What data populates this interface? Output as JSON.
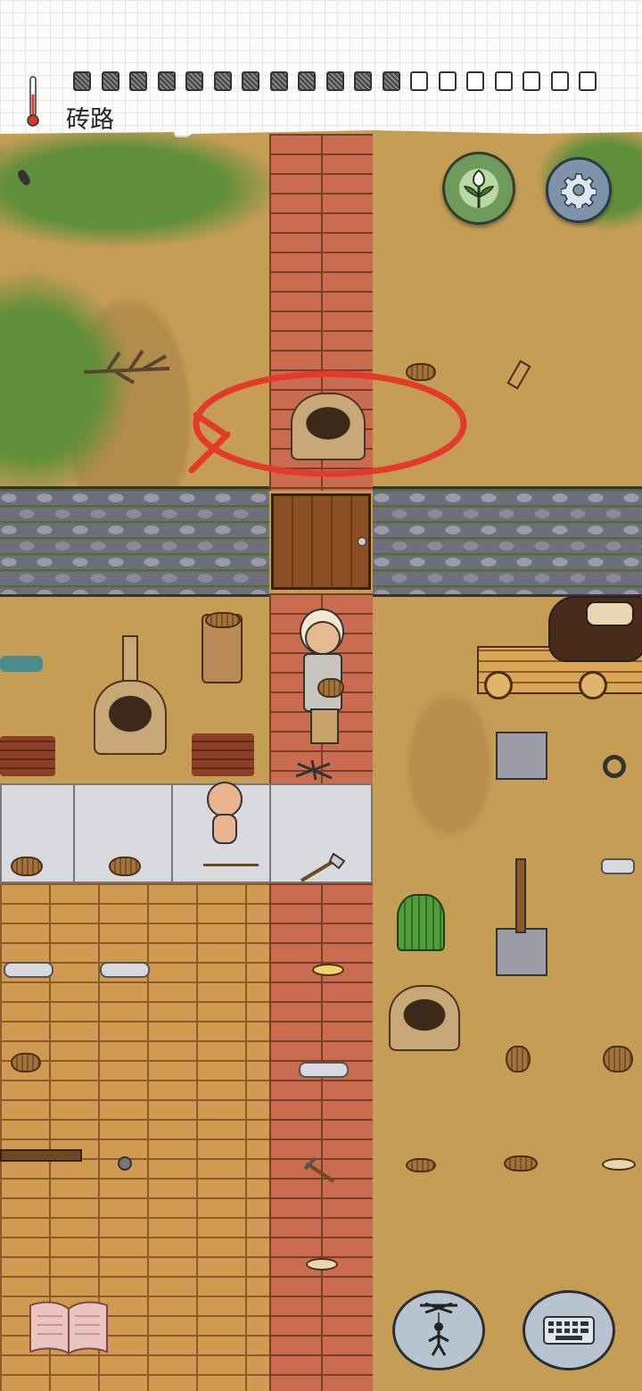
{
  "hud": {
    "biome_label": "砖路",
    "food_pips_total": 19,
    "food_pips_full": 12
  },
  "icons": {
    "thermometer": "thermometer-icon",
    "compass": "flower-compass-icon",
    "settings": "gear-icon",
    "journal": "book-icon",
    "emote": "puppet-emote-icon",
    "keyboard": "keyboard-icon"
  },
  "colors": {
    "annotation_circle": "#e23b2a",
    "brick": "#c96c4f",
    "settings_button": "#7c93a8",
    "compass_button": "#6e9a5c"
  }
}
